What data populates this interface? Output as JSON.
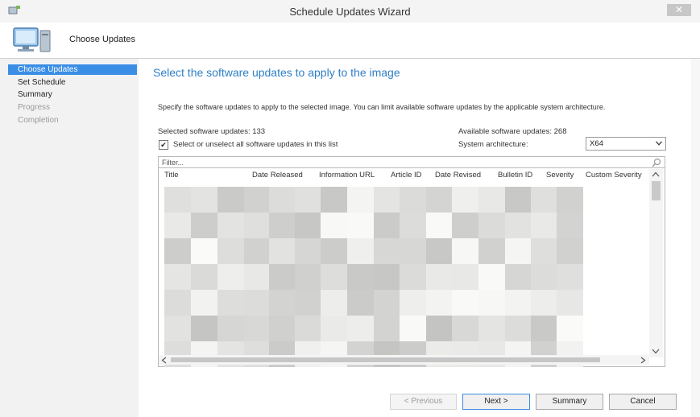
{
  "window": {
    "title": "Schedule Updates Wizard",
    "close_glyph": "✕"
  },
  "header": {
    "title": "Choose Updates",
    "icon": "computer-icon"
  },
  "sidebar": {
    "items": [
      {
        "label": "Choose Updates",
        "state": "active"
      },
      {
        "label": "Set Schedule",
        "state": "enabled"
      },
      {
        "label": "Summary",
        "state": "enabled"
      },
      {
        "label": "Progress",
        "state": "disabled"
      },
      {
        "label": "Completion",
        "state": "disabled"
      }
    ]
  },
  "main": {
    "title": "Select the software updates to apply to the image",
    "description": "Specify the software updates to apply to the selected image. You can limit available software updates by the applicable system architecture.",
    "selected_count_label": "Selected software updates: 133",
    "available_count_label": "Available software updates: 268",
    "select_all_label": "Select or unselect all software updates in this list",
    "select_all_checked": true,
    "checkbox_glyph": "✔",
    "arch_label": "System architecture:",
    "arch_value": "X64",
    "filter_placeholder": "Filter...",
    "columns": [
      "Title",
      "Date Released",
      "Information URL",
      "Article ID",
      "Date Revised",
      "Bulletin ID",
      "Severity",
      "Custom Severity"
    ]
  },
  "buttons": {
    "previous": "< Previous",
    "next": "Next >",
    "summary": "Summary",
    "cancel": "Cancel"
  },
  "colors": {
    "accent": "#3a8ee6",
    "title_blue": "#2f7fc6",
    "sidebar_bg": "#f2f2f2"
  }
}
